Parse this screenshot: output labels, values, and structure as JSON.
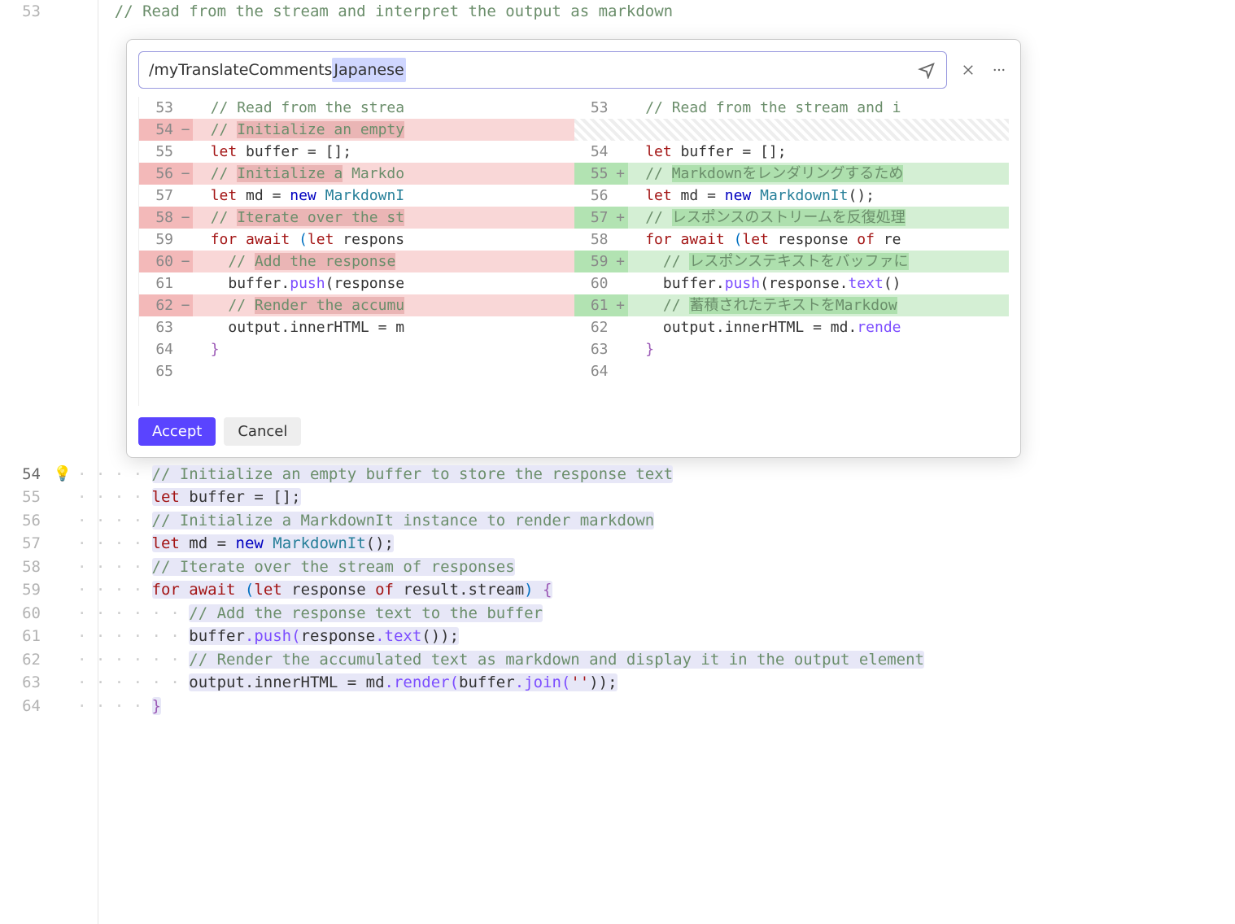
{
  "prompt": {
    "text_pre": "/myTranslateComments ",
    "text_sel": "Japanese"
  },
  "actions": {
    "accept": "Accept",
    "cancel": "Cancel"
  },
  "orig_top": {
    "line53_num": "53",
    "line53_text": "// Read from the stream and interpret the output as markdown"
  },
  "main": {
    "l54_num": "54",
    "l54_text": "// Initialize an empty buffer to store the response text",
    "l55_num": "55",
    "l55_text_pre": "let ",
    "l55_text_var": "buffer",
    "l55_text_post": " = [];",
    "l56_num": "56",
    "l56_text": "// Initialize a MarkdownIt instance to render markdown",
    "l57_num": "57",
    "l57_pre": "let ",
    "l57_var": "md",
    "l57_mid": " = ",
    "l57_new": "new ",
    "l57_type": "MarkdownIt",
    "l57_post": "();",
    "l58_num": "58",
    "l58_text": "// Iterate over the stream of responses",
    "l59_num": "59",
    "l59_for": "for ",
    "l59_await": "await ",
    "l59_paren1": "(",
    "l59_let": "let ",
    "l59_resp": "response",
    "l59_of": " of ",
    "l59_result": "result",
    "l59_dot": ".",
    "l59_stream": "stream",
    "l59_paren2": ") ",
    "l59_brace": "{",
    "l60_num": "60",
    "l60_text": "// Add the response text to the buffer",
    "l61_num": "61",
    "l61_buf": "buffer",
    "l61_push": ".push(",
    "l61_resp": "response",
    "l61_text": ".text",
    "l61_call": "());",
    "l62_num": "62",
    "l62_text": "// Render the accumulated text as markdown and display it in the output element",
    "l63_num": "63",
    "l63_out": "output",
    "l63_inner": ".innerHTML",
    "l63_eq": " = ",
    "l63_md": "md",
    "l63_render": ".render(",
    "l63_buf": "buffer",
    "l63_join": ".join(",
    "l63_str": "''",
    "l63_end": "));",
    "l64_num": "64",
    "l64_brace": "}"
  },
  "diff_left": [
    {
      "num": "53",
      "sign": "",
      "cls": "",
      "spans": [
        {
          "t": "// Read from the strea",
          "c": "tok-comment"
        }
      ]
    },
    {
      "num": "54",
      "sign": "−",
      "cls": "removed",
      "spans": [
        {
          "t": "// ",
          "c": "tok-comment"
        },
        {
          "t": "Initialize an empty",
          "c": "tok-comment hlspan"
        }
      ]
    },
    {
      "num": "55",
      "sign": "",
      "cls": "",
      "spans": [
        {
          "t": "let ",
          "c": "tok-kw"
        },
        {
          "t": "buffer",
          "c": "tok-ident"
        },
        {
          "t": " = [];",
          "c": ""
        }
      ]
    },
    {
      "num": "56",
      "sign": "−",
      "cls": "removed",
      "spans": [
        {
          "t": "// ",
          "c": "tok-comment"
        },
        {
          "t": "Initialize a",
          "c": "tok-comment hlspan"
        },
        {
          "t": " Markdo",
          "c": "tok-comment"
        }
      ]
    },
    {
      "num": "57",
      "sign": "",
      "cls": "",
      "spans": [
        {
          "t": "let ",
          "c": "tok-kw"
        },
        {
          "t": "md",
          "c": "tok-ident"
        },
        {
          "t": " = ",
          "c": ""
        },
        {
          "t": "new ",
          "c": "tok-kw2"
        },
        {
          "t": "MarkdownI",
          "c": "tok-type"
        }
      ]
    },
    {
      "num": "58",
      "sign": "−",
      "cls": "removed",
      "spans": [
        {
          "t": "// ",
          "c": "tok-comment"
        },
        {
          "t": "Iterate over the st",
          "c": "tok-comment hlspan"
        }
      ]
    },
    {
      "num": "59",
      "sign": "",
      "cls": "",
      "spans": [
        {
          "t": "for await ",
          "c": "tok-kw"
        },
        {
          "t": "(",
          "c": "tok-paren"
        },
        {
          "t": "let ",
          "c": "tok-kw"
        },
        {
          "t": "respons",
          "c": ""
        }
      ]
    },
    {
      "num": "60",
      "sign": "−",
      "cls": "removed",
      "spans": [
        {
          "t": "  ",
          "c": ""
        },
        {
          "t": "// ",
          "c": "tok-comment"
        },
        {
          "t": "Add the response",
          "c": "tok-comment hlspan"
        }
      ]
    },
    {
      "num": "61",
      "sign": "",
      "cls": "",
      "spans": [
        {
          "t": "  buffer.",
          "c": ""
        },
        {
          "t": "push",
          "c": "tok-func"
        },
        {
          "t": "(response",
          "c": ""
        }
      ]
    },
    {
      "num": "62",
      "sign": "−",
      "cls": "removed",
      "spans": [
        {
          "t": "  ",
          "c": ""
        },
        {
          "t": "// ",
          "c": "tok-comment"
        },
        {
          "t": "Render the accumu",
          "c": "tok-comment hlspan"
        }
      ]
    },
    {
      "num": "63",
      "sign": "",
      "cls": "",
      "spans": [
        {
          "t": "  output.",
          "c": ""
        },
        {
          "t": "innerHTML",
          "c": "tok-ident"
        },
        {
          "t": " = m",
          "c": ""
        }
      ]
    },
    {
      "num": "64",
      "sign": "",
      "cls": "",
      "spans": [
        {
          "t": "}",
          "c": "tok-brace"
        }
      ]
    },
    {
      "num": "65",
      "sign": "",
      "cls": "",
      "spans": []
    }
  ],
  "diff_right": [
    {
      "num": "53",
      "sign": "",
      "cls": "",
      "spans": [
        {
          "t": "// Read from the stream and i",
          "c": "tok-comment"
        }
      ]
    },
    {
      "num": "",
      "sign": "",
      "cls": "hatched",
      "spans": []
    },
    {
      "num": "54",
      "sign": "",
      "cls": "",
      "spans": [
        {
          "t": "let ",
          "c": "tok-kw"
        },
        {
          "t": "buffer",
          "c": "tok-ident"
        },
        {
          "t": " = [];",
          "c": ""
        }
      ]
    },
    {
      "num": "55",
      "sign": "+",
      "cls": "added",
      "spans": [
        {
          "t": "// ",
          "c": "tok-comment"
        },
        {
          "t": "Markdownをレンダリングするため",
          "c": "tok-comment hlspan"
        }
      ]
    },
    {
      "num": "56",
      "sign": "",
      "cls": "",
      "spans": [
        {
          "t": "let ",
          "c": "tok-kw"
        },
        {
          "t": "md",
          "c": "tok-ident"
        },
        {
          "t": " = ",
          "c": ""
        },
        {
          "t": "new ",
          "c": "tok-kw2"
        },
        {
          "t": "MarkdownIt",
          "c": "tok-type"
        },
        {
          "t": "();",
          "c": ""
        }
      ]
    },
    {
      "num": "57",
      "sign": "+",
      "cls": "added",
      "spans": [
        {
          "t": "// ",
          "c": "tok-comment"
        },
        {
          "t": "レスポンスのストリームを反復処理",
          "c": "tok-comment hlspan"
        }
      ]
    },
    {
      "num": "58",
      "sign": "",
      "cls": "",
      "spans": [
        {
          "t": "for await ",
          "c": "tok-kw"
        },
        {
          "t": "(",
          "c": "tok-paren"
        },
        {
          "t": "let ",
          "c": "tok-kw"
        },
        {
          "t": "response",
          "c": ""
        },
        {
          "t": " of ",
          "c": "tok-kw"
        },
        {
          "t": "re",
          "c": ""
        }
      ]
    },
    {
      "num": "59",
      "sign": "+",
      "cls": "added",
      "spans": [
        {
          "t": "  ",
          "c": ""
        },
        {
          "t": "// ",
          "c": "tok-comment"
        },
        {
          "t": "レスポンステキストをバッファに",
          "c": "tok-comment hlspan"
        }
      ]
    },
    {
      "num": "60",
      "sign": "",
      "cls": "",
      "spans": [
        {
          "t": "  buffer.",
          "c": ""
        },
        {
          "t": "push",
          "c": "tok-func"
        },
        {
          "t": "(response.",
          "c": ""
        },
        {
          "t": "text",
          "c": "tok-func"
        },
        {
          "t": "()",
          "c": ""
        }
      ]
    },
    {
      "num": "61",
      "sign": "+",
      "cls": "added",
      "spans": [
        {
          "t": "  ",
          "c": ""
        },
        {
          "t": "// ",
          "c": "tok-comment"
        },
        {
          "t": "蓄積されたテキストをMarkdow",
          "c": "tok-comment hlspan"
        }
      ]
    },
    {
      "num": "62",
      "sign": "",
      "cls": "",
      "spans": [
        {
          "t": "  output.",
          "c": ""
        },
        {
          "t": "innerHTML",
          "c": "tok-ident"
        },
        {
          "t": " = md.",
          "c": ""
        },
        {
          "t": "rende",
          "c": "tok-func"
        }
      ]
    },
    {
      "num": "63",
      "sign": "",
      "cls": "",
      "spans": [
        {
          "t": "}",
          "c": "tok-brace"
        }
      ]
    },
    {
      "num": "64",
      "sign": "",
      "cls": "",
      "spans": []
    }
  ]
}
